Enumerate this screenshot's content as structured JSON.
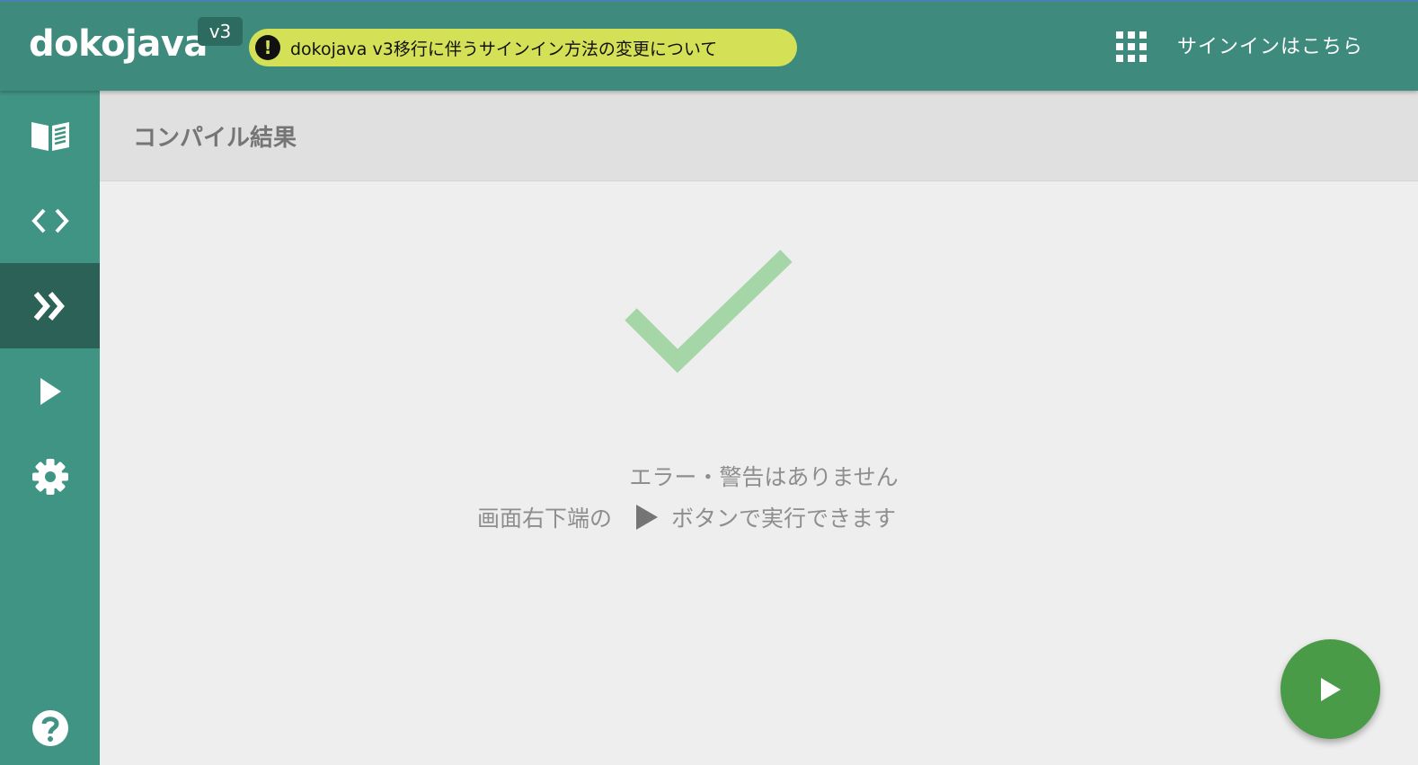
{
  "header": {
    "logo": "dokojava",
    "version": "v3",
    "notice_text": "dokojava v3移行に伴うサインイン方法の変更について",
    "signin_label": "サインインはこちら"
  },
  "sidebar": {
    "items": [
      {
        "name": "book-icon",
        "active": false
      },
      {
        "name": "code-icon",
        "active": false
      },
      {
        "name": "compile-icon",
        "active": true
      },
      {
        "name": "play-icon",
        "active": false
      },
      {
        "name": "gear-icon",
        "active": false
      },
      {
        "name": "help-icon",
        "active": false
      }
    ]
  },
  "content": {
    "title": "コンパイル結果",
    "message_line1": "エラー・警告はありません",
    "message_line2_before": "画面右下端の",
    "message_line2_after": "ボタンで実行できます"
  },
  "colors": {
    "header": "#3e8a7c",
    "sidebar": "#409484",
    "sidebar_active": "#2b6156",
    "notice_bg": "#d4e157",
    "check": "#a5d6a7",
    "fab": "#4a9b48"
  }
}
